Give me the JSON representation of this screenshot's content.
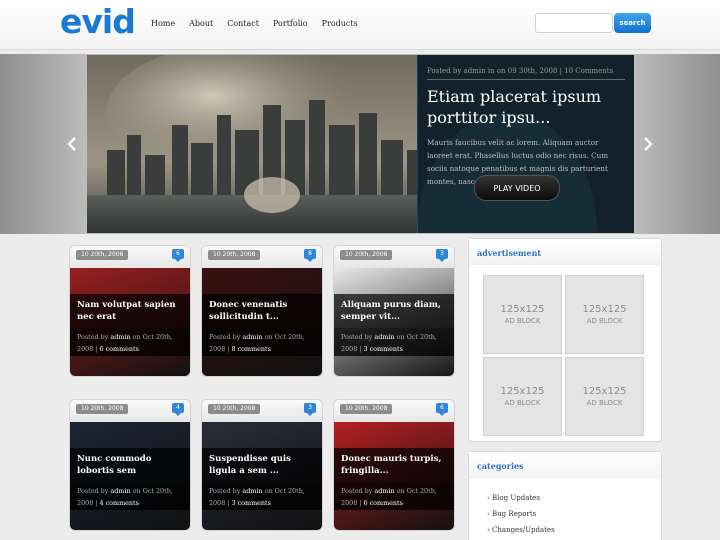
{
  "header": {
    "logo": "evid",
    "nav": [
      "Home",
      "About",
      "Contact",
      "Portfolio",
      "Products"
    ],
    "search_placeholder": "",
    "search_button": "search"
  },
  "slider": {
    "meta": "Posted by admin in on 09 30th, 2008 | 10 Comments",
    "title": "Etiam placerat ipsum porttitor ipsu...",
    "excerpt": "Mauris faucibus velit ac lorem. Aliquam auctor laoreet erat. Phasellus luctus odio nec risus. Cum sociis natoque penatibus et magnis dis parturient montes, nascetur ridiculus mus....",
    "play_label": "PLAY VIDEO",
    "prev_icon": "chevron-left-icon",
    "next_icon": "chevron-right-icon"
  },
  "posts": [
    {
      "date": "10 20th, 2008",
      "comments": "6",
      "title": "Nam volutpat sapien nec erat",
      "author": "admin",
      "on": "Oct 20th,",
      "year": "2008",
      "ccount": "6 comments",
      "img": "#9b1f1f"
    },
    {
      "date": "10 20th, 2008",
      "comments": "8",
      "title": "Donec venenatis sollicitudin t...",
      "author": "admin",
      "on": "Oct 20th,",
      "year": "2008",
      "ccount": "8 comments",
      "img": "#3a1010"
    },
    {
      "date": "10 20th, 2008",
      "comments": "3",
      "title": "Aliquam purus diam, semper vit...",
      "author": "admin",
      "on": "Oct 20th,",
      "year": "2008",
      "ccount": "3 comments",
      "img": "#e8e8e8"
    },
    {
      "date": "10 20th, 2008",
      "comments": "4",
      "title": "Nunc commodo lobortis sem",
      "author": "admin",
      "on": "Oct 20th,",
      "year": "2008",
      "ccount": "4 comments",
      "img": "#1c2635"
    },
    {
      "date": "10 20th, 2008",
      "comments": "3",
      "title": "Suspendisse quis ligula a sem ...",
      "author": "admin",
      "on": "Oct 20th,",
      "year": "2008",
      "ccount": "3 comments",
      "img": "#2a2d3a"
    },
    {
      "date": "10 20th, 2008",
      "comments": "6",
      "title": "Donec mauris turpis, fringilla...",
      "author": "admin",
      "on": "Oct 20th,",
      "year": "2008",
      "ccount": "6 comments",
      "img": "#b42020"
    }
  ],
  "post_poster": "Posted by",
  "post_on": "on",
  "sidebar": {
    "ad_title": "advertisement",
    "ads": [
      {
        "size": "125x125",
        "label": "AD BLOCK"
      },
      {
        "size": "125x125",
        "label": "AD BLOCK"
      },
      {
        "size": "125x125",
        "label": "AD BLOCK"
      },
      {
        "size": "125x125",
        "label": "AD BLOCK"
      }
    ],
    "cat_title": "categories",
    "categories": [
      "Blog Updates",
      "Bug Reports",
      "Changes/Updates"
    ]
  },
  "colors": {
    "accent": "#1b79d1",
    "search": "#1a7fdc"
  }
}
